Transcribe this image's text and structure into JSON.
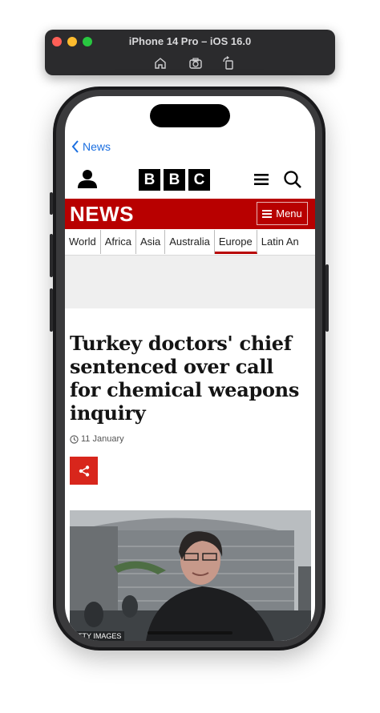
{
  "simulator": {
    "title": "iPhone 14 Pro – iOS 16.0",
    "tools": [
      "home-icon",
      "screenshot-icon",
      "rotate-icon"
    ]
  },
  "app": {
    "back_label": "News",
    "brand": [
      "B",
      "B",
      "C"
    ],
    "section_title": "NEWS",
    "menu_label": "Menu",
    "tabs": [
      {
        "label": "World"
      },
      {
        "label": "Africa"
      },
      {
        "label": "Asia"
      },
      {
        "label": "Australia"
      },
      {
        "label": "Europe",
        "active": true
      },
      {
        "label": "Latin An"
      }
    ]
  },
  "article": {
    "headline": "Turkey doctors' chief sentenced over call for chemical weapons inquiry",
    "date": "11 January",
    "image_credit": "TTY IMAGES"
  },
  "colors": {
    "accent": "#b80000",
    "share": "#d8261c",
    "link": "#1b6fe0"
  }
}
